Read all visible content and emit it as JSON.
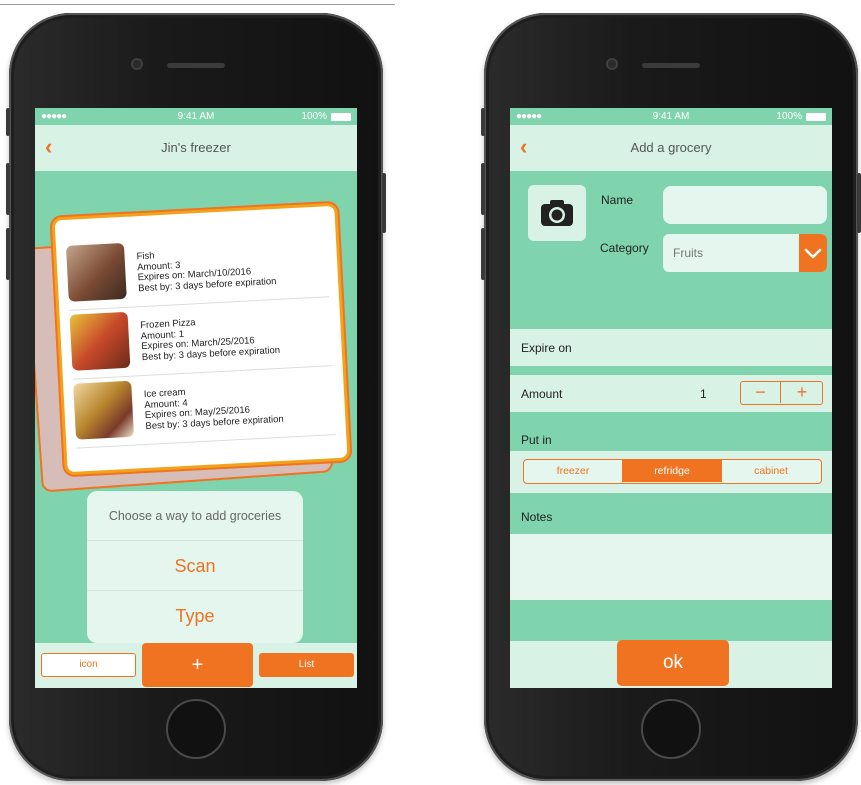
{
  "status": {
    "signal": "●●●●● ",
    "time": "9:41 AM",
    "battery": "100%"
  },
  "left": {
    "nav": {
      "back": "‹",
      "title": "Jin's freezer"
    },
    "items": [
      {
        "name": "Fish",
        "amount": "Amount: 3",
        "expires": "Expires on: March/10/2016",
        "best": "Best by: 3 days before expiration",
        "thumb_color": "#7a4a34"
      },
      {
        "name": "Frozen Pizza",
        "amount": "Amount: 1",
        "expires": "Expires on: March/25/2016",
        "best": "Best by: 3 days before expiration",
        "thumb_color": "#c7492a"
      },
      {
        "name": "Ice cream",
        "amount": "Amount: 4",
        "expires": "Expires on: May/25/2016",
        "best": "Best by: 3 days before expiration",
        "thumb_color": "#b8862e"
      }
    ],
    "sheet": {
      "prompt": "Choose a way to add groceries",
      "scan": "Scan",
      "type": "Type"
    },
    "tabbar": {
      "icon": "icon",
      "plus": "+",
      "list": "List"
    }
  },
  "right": {
    "nav": {
      "back": "‹",
      "title": "Add a grocery"
    },
    "form": {
      "name_label": "Name",
      "name_value": "",
      "category_label": "Category",
      "category_value": "Fruits",
      "expire_label": "Expire on",
      "amount_label": "Amount",
      "amount_value": "1",
      "minus": "−",
      "plus": "+",
      "putin_label": "Put in",
      "segments": [
        "freezer",
        "refridge",
        "cabinet"
      ],
      "selected_segment": "refridge",
      "notes_label": "Notes"
    },
    "ok": "ok"
  },
  "colors": {
    "accent": "#f07322",
    "mint": "#7fd4ad",
    "pale": "#d9f2e6"
  }
}
